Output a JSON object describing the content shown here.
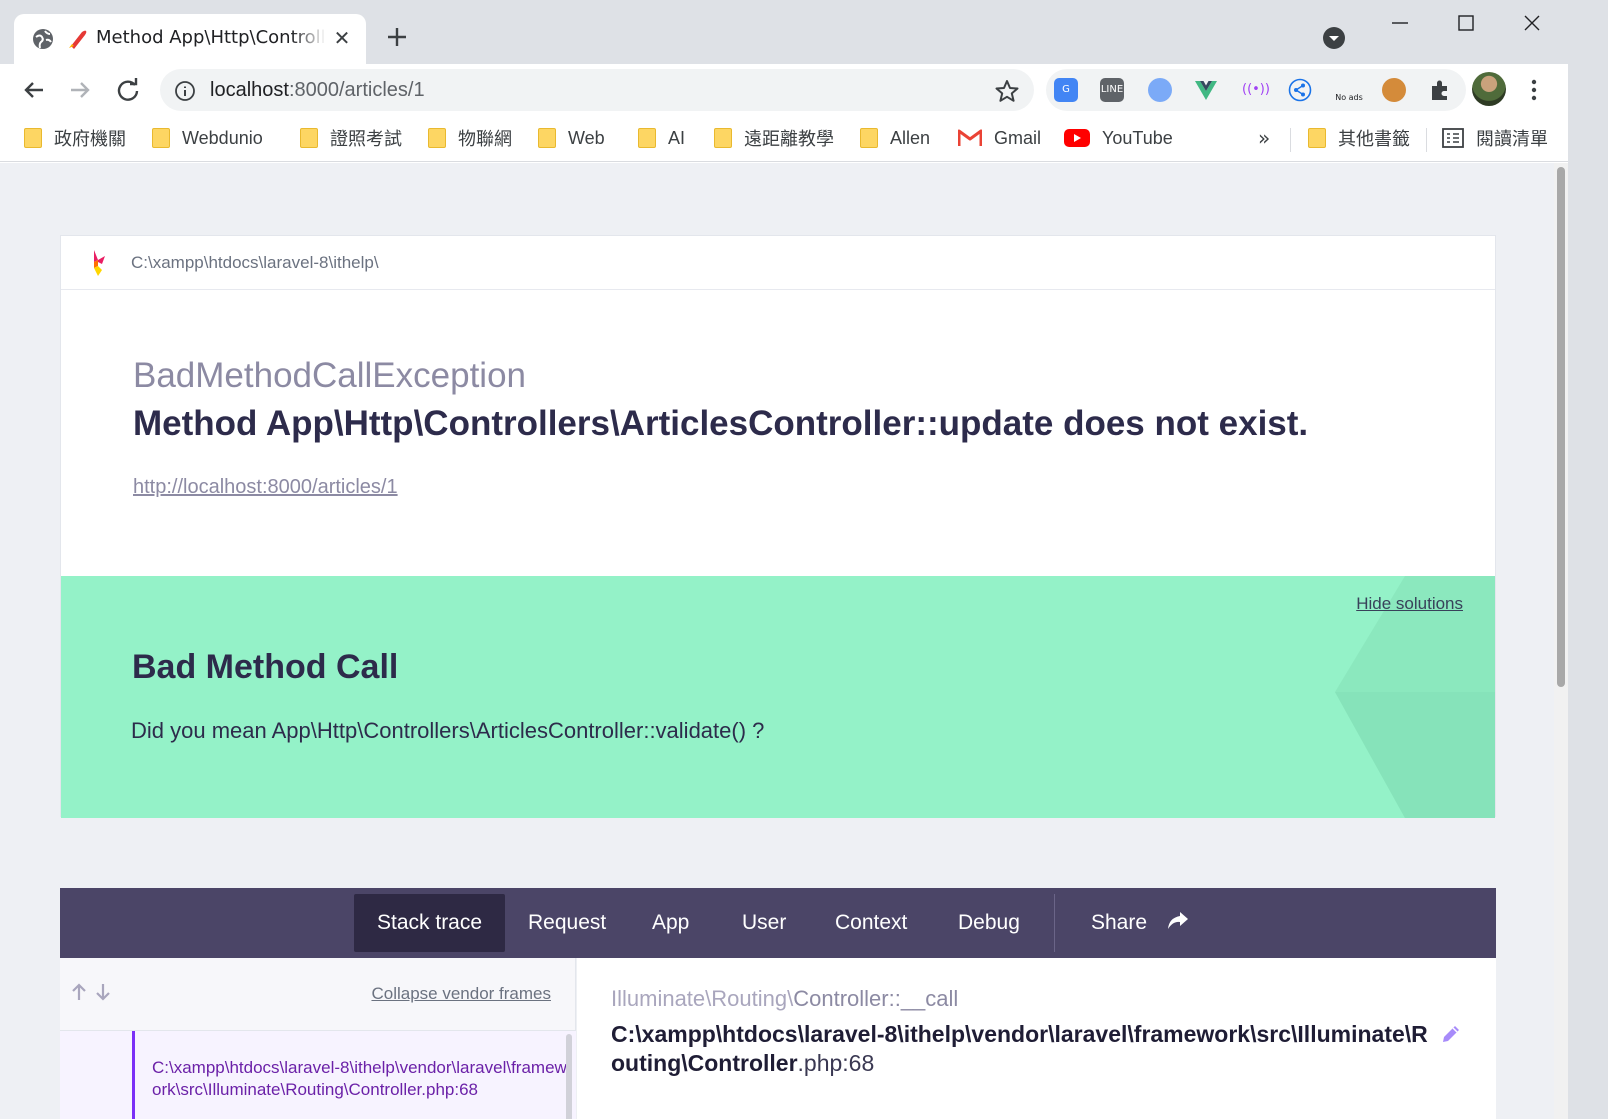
{
  "browser": {
    "tab_title": "Method App\\Http\\Controllers\\ArticlesController::update does not exist.",
    "tab_close": "✕",
    "url_host": "localhost",
    "url_rest": ":8000/articles/1",
    "ext_no_ads": "No ads",
    "bookmarks": [
      {
        "label": "政府機關",
        "icon": "folder-icon"
      },
      {
        "label": "Webdunio",
        "icon": "folder-icon"
      },
      {
        "label": "證照考試",
        "icon": "folder-icon"
      },
      {
        "label": "物聯網",
        "icon": "folder-icon"
      },
      {
        "label": "Web",
        "icon": "folder-icon"
      },
      {
        "label": "AI",
        "icon": "folder-icon"
      },
      {
        "label": "遠距離教學",
        "icon": "folder-icon"
      },
      {
        "label": "Allen",
        "icon": "folder-icon"
      },
      {
        "label": "Gmail",
        "icon": "gmail-icon"
      },
      {
        "label": "YouTube",
        "icon": "youtube-icon"
      }
    ],
    "bookmarks_overflow": "»",
    "other_bookmarks": "其他書籤",
    "reading_list": "閱讀清單"
  },
  "page": {
    "project_path": "C:\\xampp\\htdocs\\laravel-8\\ithelp\\",
    "exception_class": "BadMethodCallException",
    "exception_message": "Method App\\Http\\Controllers\\ArticlesController::update does not exist.",
    "request_url": "http://localhost:8000/articles/1",
    "solution": {
      "hide_label": "Hide solutions",
      "title": "Bad Method Call",
      "description": "Did you mean App\\Http\\Controllers\\ArticlesController::validate() ?",
      "bg_color": "#94f2c8"
    },
    "tabs": [
      {
        "label": "Stack trace",
        "active": true
      },
      {
        "label": "Request"
      },
      {
        "label": "App"
      },
      {
        "label": "User"
      },
      {
        "label": "Context"
      },
      {
        "label": "Debug"
      },
      {
        "label": "Share"
      }
    ],
    "frames": {
      "collapse_label": "Collapse vendor frames",
      "first_frame_path": "C:\\xampp\\htdocs\\laravel-8\\ithelp\\vendor\\laravel\\framework\\src\\Illuminate\\Routing\\Controller.php:68"
    },
    "detail": {
      "namespace": "Illuminate\\Routing\\",
      "method": "Controller::__call",
      "file_path": "C:\\xampp\\htdocs\\laravel-8\\ithelp\\vendor\\laravel\\framework\\src\\Illuminate\\Routing\\Controller",
      "file_ext_line": ".php:68"
    },
    "colors": {
      "nav_bg": "#4b4567",
      "nav_active": "#2e2944",
      "frame_accent": "#7b2ff7",
      "page_bg": "#eef0f4"
    }
  }
}
